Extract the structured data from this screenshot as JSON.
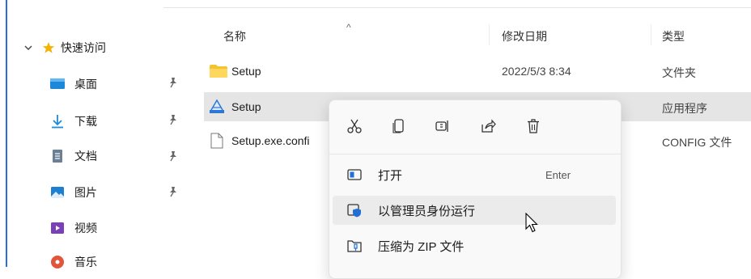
{
  "nav": {
    "quick_access": "快速访问",
    "items": [
      {
        "label": "桌面",
        "icon": "desktop-icon",
        "pinned": true
      },
      {
        "label": "下载",
        "icon": "download-icon",
        "pinned": true
      },
      {
        "label": "文档",
        "icon": "documents-icon",
        "pinned": true
      },
      {
        "label": "图片",
        "icon": "pictures-icon",
        "pinned": true
      },
      {
        "label": "视频",
        "icon": "videos-icon",
        "pinned": false
      },
      {
        "label": "音乐",
        "icon": "music-icon",
        "pinned": false
      }
    ]
  },
  "columns": {
    "name": "名称",
    "date": "修改日期",
    "type": "类型",
    "sort_indicator": "^"
  },
  "files": [
    {
      "name": "Setup",
      "date": "2022/5/3 8:34",
      "type": "文件夹",
      "icon": "folder-icon"
    },
    {
      "name": "Setup",
      "date": "",
      "type": "应用程序",
      "icon": "setup-app-icon",
      "selected": true
    },
    {
      "name": "Setup.exe.confi",
      "date": "",
      "type": "CONFIG 文件",
      "icon": "file-icon"
    }
  ],
  "context_menu": {
    "quick_actions": [
      "cut-icon",
      "copy-icon",
      "rename-icon",
      "share-icon",
      "delete-icon"
    ],
    "items": [
      {
        "label": "打开",
        "shortcut": "Enter",
        "icon": "open-icon"
      },
      {
        "label": "以管理员身份运行",
        "shortcut": "",
        "icon": "run-as-admin-icon",
        "hovered": true
      },
      {
        "label": "压缩为 ZIP 文件",
        "shortcut": "",
        "icon": "zip-icon"
      }
    ]
  },
  "colors": {
    "accent": "#0067c0",
    "selection": "#e5e5e5",
    "folder": "#f4c430",
    "star": "#f5b301"
  }
}
